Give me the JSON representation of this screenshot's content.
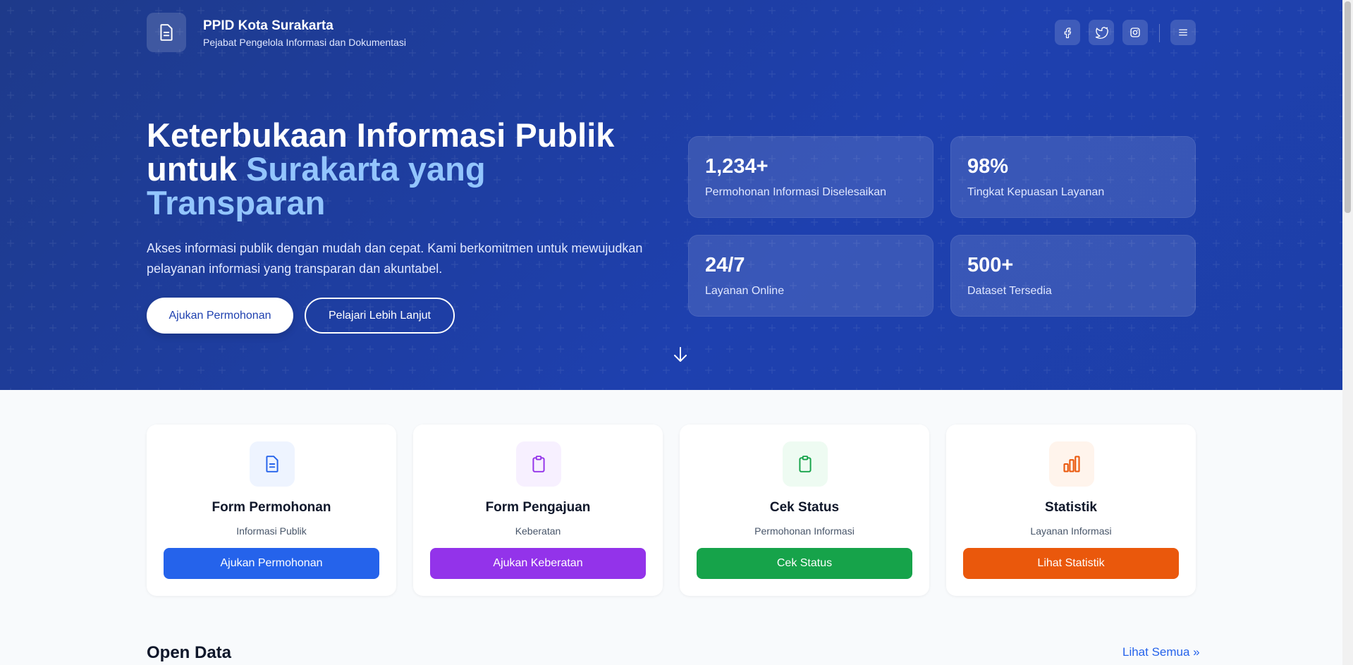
{
  "header": {
    "brand_title": "PPID Kota Surakarta",
    "brand_subtitle": "Pejabat Pengelola Informasi dan Dokumentasi",
    "social_icons": [
      "facebook-icon",
      "twitter-icon",
      "instagram-icon"
    ],
    "menu_icon": "menu-icon"
  },
  "hero": {
    "title_line1": "Keterbukaan Informasi Publik",
    "title_line2_prefix": "untuk",
    "title_accent_1": "Surakarta yang",
    "title_accent_2": "Transparan",
    "description": "Akses informasi publik dengan mudah dan cepat. Kami berkomitmen untuk mewujudkan pelayanan informasi yang transparan dan akuntabel.",
    "primary_button": "Ajukan Permohonan",
    "secondary_button": "Pelajari Lebih Lanjut",
    "stats": [
      {
        "value": "1,234+",
        "label": "Permohonan Informasi Diselesaikan"
      },
      {
        "value": "98%",
        "label": "Tingkat Kepuasan Layanan"
      },
      {
        "value": "24/7",
        "label": "Layanan Online"
      },
      {
        "value": "500+",
        "label": "Dataset Tersedia"
      }
    ]
  },
  "services": [
    {
      "title": "Form Permohonan",
      "subtitle": "Informasi Publik",
      "button": "Ajukan Permohonan",
      "icon": "document-icon",
      "color": "#2563eb",
      "tint": "#eef4ff"
    },
    {
      "title": "Form Pengajuan",
      "subtitle": "Keberatan",
      "button": "Ajukan Keberatan",
      "icon": "clipboard-icon",
      "color": "#9333ea",
      "tint": "#f7f0ff"
    },
    {
      "title": "Cek Status",
      "subtitle": "Permohonan Informasi",
      "button": "Cek Status",
      "icon": "clipboard-check-icon",
      "color": "#16a34a",
      "tint": "#eefbf2"
    },
    {
      "title": "Statistik",
      "subtitle": "Layanan Informasi",
      "button": "Lihat Statistik",
      "icon": "bar-chart-icon",
      "color": "#ea580c",
      "tint": "#fff4ec"
    }
  ],
  "open_data": {
    "title": "Open Data",
    "link": "Lihat Semua »"
  }
}
